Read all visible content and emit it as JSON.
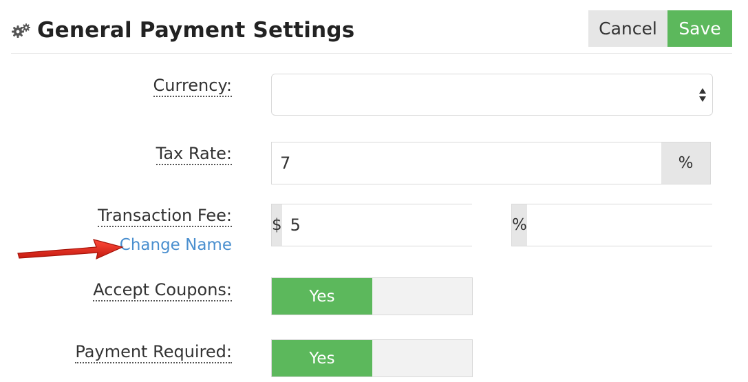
{
  "header": {
    "title": "General Payment Settings",
    "cancel_label": "Cancel",
    "save_label": "Save"
  },
  "form": {
    "currency": {
      "label": "Currency:",
      "value": ""
    },
    "tax_rate": {
      "label": "Tax Rate:",
      "value": "7",
      "suffix": "%"
    },
    "transaction_fee": {
      "label": "Transaction Fee:",
      "fixed_prefix": "$",
      "fixed_value": "5",
      "percent_prefix": "%",
      "percent_value": "",
      "change_name_link": "Change Name"
    },
    "accept_coupons": {
      "label": "Accept Coupons:",
      "toggle_label": "Yes"
    },
    "payment_required": {
      "label": "Payment Required:",
      "toggle_label": "Yes"
    }
  },
  "colors": {
    "primary_green": "#5cb85c",
    "link_blue": "#4a8fcf",
    "annotation_red": "#e02b1f"
  },
  "icons": {
    "title_icon": "gears-icon",
    "select_icon": "updown-arrows-icon",
    "annotation": "red-arrow-pointer-icon"
  }
}
